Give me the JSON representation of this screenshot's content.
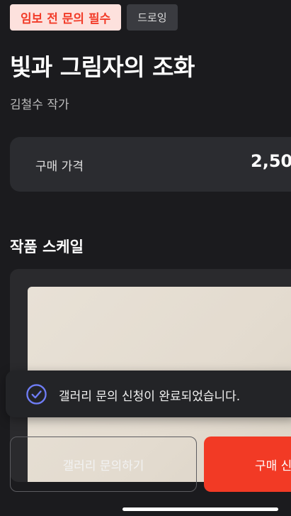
{
  "tags": {
    "primary": "임보 전 문의 필수",
    "secondary": "드로잉"
  },
  "artwork": {
    "title": "빛과 그림자의 조화",
    "artist": "김철수 작가"
  },
  "price": {
    "label": "구매 가격",
    "value": "2,50"
  },
  "scale_section": {
    "title": "작품 스케일"
  },
  "toast": {
    "icon": "check-circle-icon",
    "message": "갤러리 문의 신청이 완료되었습니다."
  },
  "actions": {
    "inquiry_label": "갤러리 문의하기",
    "buy_label": "구매 신"
  },
  "colors": {
    "accent": "#f23a25",
    "tag_bg": "#fde1dd",
    "background": "#1b1b1e",
    "card": "#2b2c30",
    "toast_icon": "#6f7df5"
  }
}
